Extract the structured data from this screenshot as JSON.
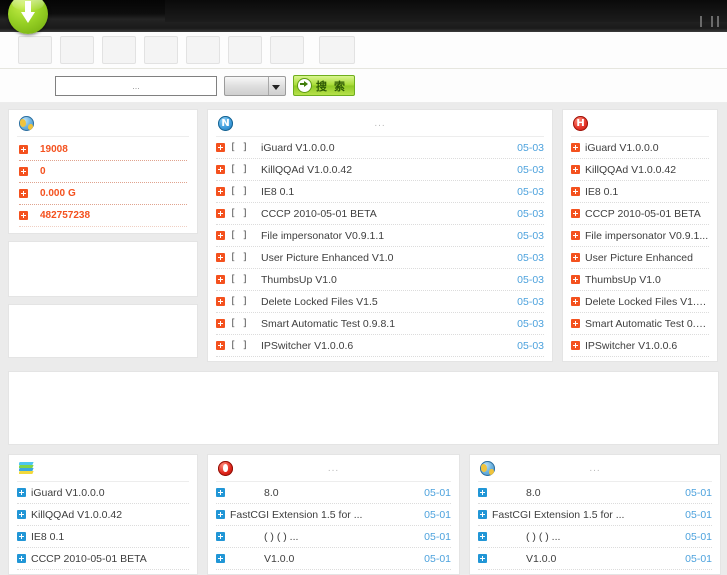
{
  "titlebar": {
    "logo_icon": "download-arrow-logo",
    "window_controls": [
      "minimize",
      "restore",
      "close"
    ]
  },
  "nav": {
    "buttons": [
      {
        "name": "nav-button-1",
        "label": ""
      },
      {
        "name": "nav-button-2",
        "label": ""
      },
      {
        "name": "nav-button-3",
        "label": ""
      },
      {
        "name": "nav-button-4",
        "label": ""
      },
      {
        "name": "nav-button-5",
        "label": ""
      },
      {
        "name": "nav-button-6",
        "label": ""
      },
      {
        "name": "nav-button-7",
        "label": ""
      },
      {
        "name": "nav-button-8",
        "label": ""
      }
    ]
  },
  "search": {
    "value": "...",
    "placeholder": "...",
    "category_selected": "",
    "button_label": "搜 索",
    "button_icon": "arrow-right-circle-icon"
  },
  "panels": {
    "stats": {
      "icon": "globe-icon",
      "rows": [
        {
          "value": "19008",
          "unit": ""
        },
        {
          "value": "0",
          "unit": ""
        },
        {
          "value": "0.000",
          "unit": "G"
        },
        {
          "value": "482757238",
          "unit": ""
        }
      ]
    },
    "blank_left_1": {},
    "blank_left_2": {},
    "downloads": {
      "icon": "n-circle-icon",
      "dots": "...",
      "items": [
        {
          "bracket": "[   ]",
          "title": "iGuard V1.0.0.0",
          "date": "05-03"
        },
        {
          "bracket": "[   ]",
          "title": "KillQQAd V1.0.0.42",
          "date": "05-03"
        },
        {
          "bracket": "[   ]",
          "title": "IE8   0.1",
          "date": "05-03"
        },
        {
          "bracket": "[   ]",
          "title": "CCCP 2010-05-01 BETA",
          "date": "05-03"
        },
        {
          "bracket": "[   ]",
          "title": "File impersonator V0.9.1.1",
          "date": "05-03"
        },
        {
          "bracket": "[   ]",
          "title": "User Picture Enhanced V1.0",
          "date": "05-03"
        },
        {
          "bracket": "[   ]",
          "title": "ThumbsUp V1.0",
          "date": "05-03"
        },
        {
          "bracket": "[   ]",
          "title": "Delete Locked Files V1.5",
          "date": "05-03"
        },
        {
          "bracket": "[   ]",
          "title": "Smart Automatic Test 0.9.8.1",
          "date": "05-03"
        },
        {
          "bracket": "[   ]",
          "title": "IPSwitcher V1.0.0.6",
          "date": "05-03"
        }
      ]
    },
    "hot": {
      "icon": "h-circle-icon",
      "items": [
        {
          "title": "iGuard V1.0.0.0"
        },
        {
          "title": "KillQQAd V1.0.0.42"
        },
        {
          "title": "IE8   0.1"
        },
        {
          "title": "CCCP 2010-05-01 BETA"
        },
        {
          "title": "File impersonator V0.9.1..."
        },
        {
          "title": "User Picture Enhanced"
        },
        {
          "title": "ThumbsUp V1.0"
        },
        {
          "title": "Delete Locked Files V1.5..."
        },
        {
          "title": "Smart Automatic Test 0.9..."
        },
        {
          "title": "IPSwitcher V1.0.0.6"
        }
      ]
    },
    "wide_blank": {},
    "bottom_left": {
      "icon": "color-flag-icon",
      "items": [
        {
          "title": "iGuard V1.0.0.0"
        },
        {
          "title": "KillQQAd V1.0.0.42"
        },
        {
          "title": "IE8   0.1"
        },
        {
          "title": "CCCP 2010-05-01 BETA"
        }
      ]
    },
    "bottom_mid": {
      "icon": "red-shield-icon",
      "dots": "...",
      "items": [
        {
          "title": "8.0",
          "date": "05-01",
          "indent": true
        },
        {
          "title": "FastCGI Extension 1.5 for ...",
          "date": "05-01",
          "indent": false
        },
        {
          "title": "(  ) (  )  ...",
          "date": "05-01",
          "indent": true
        },
        {
          "title": "V1.0.0",
          "date": "05-01",
          "indent": true
        }
      ]
    },
    "bottom_right": {
      "icon": "globe-icon",
      "dots": "...",
      "items": [
        {
          "title": "8.0",
          "date": "05-01",
          "indent": true
        },
        {
          "title": "FastCGI Extension 1.5 for ...",
          "date": "05-01",
          "indent": false
        },
        {
          "title": "(  ) (  )  ...",
          "date": "05-01",
          "indent": true
        },
        {
          "title": "V1.0.0",
          "date": "05-01",
          "indent": true
        }
      ]
    }
  },
  "colors": {
    "accent_orange": "#f4511e",
    "accent_blue": "#2196d6",
    "link_blue": "#4da2dd",
    "search_green": "#8fc924"
  }
}
